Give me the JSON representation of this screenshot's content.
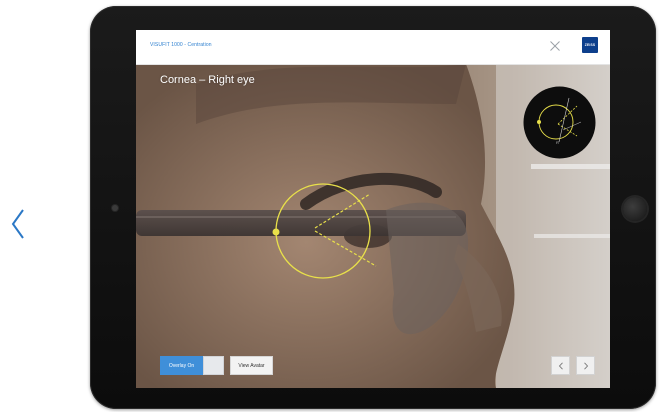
{
  "app": {
    "title": "VISUFIT 1000 - Centration",
    "brand_logo_text": "ZEISS",
    "brand_color": "#0d3f8c"
  },
  "screen": {
    "title": "Cornea – Right eye"
  },
  "minimap": {
    "label": "R"
  },
  "controls": {
    "overlay_toggle_label": "Overlay On",
    "view_avatar_label": "View Avatar"
  },
  "icons": {
    "carousel_prev": "chevron-left-icon",
    "close": "close-icon",
    "nav_prev": "chevron-left-icon",
    "nav_next": "chevron-right-icon"
  },
  "colors": {
    "accent": "#3f8fd9",
    "overlay": "#e8e04a",
    "carousel_arrow": "#2b78c6"
  }
}
